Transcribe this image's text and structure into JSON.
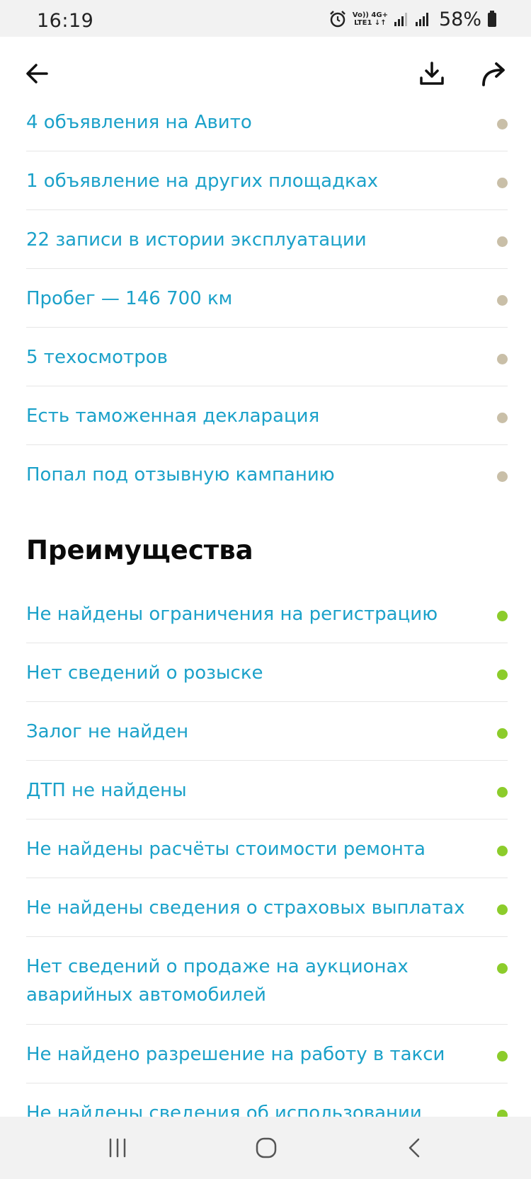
{
  "status_bar": {
    "time": "16:19",
    "net_top": "Vo)) 4G+",
    "net_bottom": "LTE1 ↓↑",
    "battery": "58%"
  },
  "icons": {
    "back": "arrow-left-icon",
    "download": "download-icon",
    "share": "share-icon"
  },
  "colors": {
    "link": "#1ba1c9",
    "neutral_dot": "#c9bfa8",
    "good_dot": "#8ccc2b"
  },
  "info_items": [
    {
      "text": "4 объявления на Авито"
    },
    {
      "text": "1 объявление на других площадках"
    },
    {
      "text": "22 записи в истории эксплуатации"
    },
    {
      "text": "Пробег — 146 700 км"
    },
    {
      "text": "5 техосмотров"
    },
    {
      "text": "Есть таможенная декларация"
    },
    {
      "text": "Попал под отзывную кампанию"
    }
  ],
  "advantages": {
    "title": "Преимущества",
    "items": [
      {
        "text": "Не найдены ограничения на регистрацию"
      },
      {
        "text": "Нет сведений о розыске"
      },
      {
        "text": "Залог не найден"
      },
      {
        "text": "ДТП не найдены"
      },
      {
        "text": "Не найдены расчёты стоимости ремонта"
      },
      {
        "text": "Не найдены сведения о страховых выплатах"
      },
      {
        "text": "Нет сведений о продаже на аукционах аварийных автомобилей"
      },
      {
        "text": "Не найдено разрешение на работу в такси"
      },
      {
        "text": "Не найдены сведения об использовании"
      }
    ]
  }
}
